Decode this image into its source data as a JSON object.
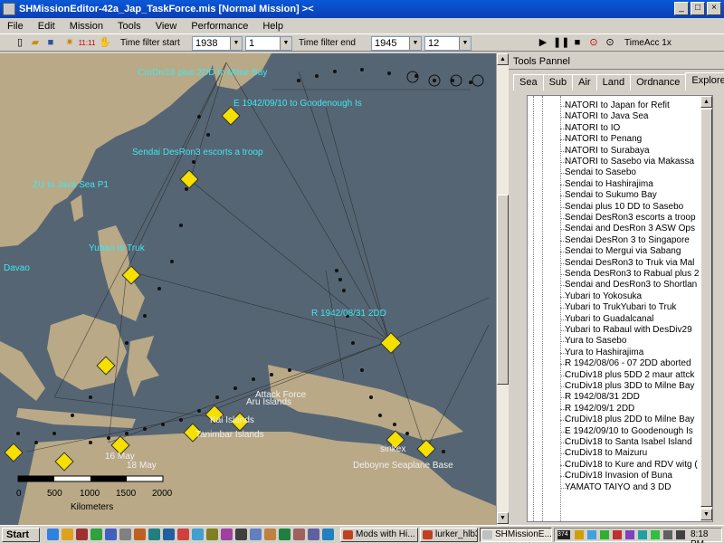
{
  "window": {
    "title": "SHMissionEditor-42a_Jap_TaskForce.mis [Normal Mission]  ><"
  },
  "menu": [
    "File",
    "Edit",
    "Mission",
    "Tools",
    "View",
    "Performance",
    "Help"
  ],
  "toolbar": {
    "time_start_label": "Time filter start",
    "start_year": "1938",
    "start_month": "1",
    "time_end_label": "Time filter end",
    "end_year": "1945",
    "end_month": "12",
    "timeacc": "TimeAcc 1x",
    "filter_icon_text": "11:11"
  },
  "map": {
    "labels": [
      "CruDiv18 plus 2DD to Milne Bay",
      "E 1942/09/10 to Goodenough Is",
      "ZU to Java Sea P1",
      "Sendai DesRon3 escorts a troop",
      "Yubari to Truk",
      "R 1942/08/31 2DD",
      "Kai Islands",
      "Aru Islands",
      "Tanimbar Islands",
      "Deboyne Seaplane Base",
      "sinkex",
      "16 May",
      "18 May",
      "Davao",
      "Attack Force"
    ],
    "scale": {
      "ticks": [
        "0",
        "500",
        "1000",
        "1500",
        "2000"
      ],
      "unit": "Kilometers"
    }
  },
  "panel": {
    "title": "Tools Pannel",
    "tabs": [
      "Sea",
      "Sub",
      "Air",
      "Land",
      "Ordnance",
      "Explorer"
    ],
    "active_tab": "Explorer",
    "tree": [
      "NATORI to Japan for Refit",
      "NATORI to Java Sea",
      "NATORI to IO",
      "NATORI to Penang",
      "NATORI to Surabaya",
      "NATORI to Sasebo via Makassa",
      "Sendai to Sasebo",
      "Sendai to Hashirajima",
      "Sendai to Sukumo Bay",
      "Sendai plus 10 DD to Sasebo",
      "Sendai DesRon3 escorts a troop",
      "Sendai and DesRon 3 ASW Ops",
      "Sendai DesRon 3 to Singapore",
      "Sendai to Mergui via Sabang",
      "Sendai DesRon3 to Truk via Mal",
      "Senda DesRon3 to Rabual plus 2",
      "Sendai and DesRon3 to Shortlan",
      "Yubari to Yokosuka",
      "Yubari to TrukYubari to Truk",
      "Yubari to Guadalcanal",
      "Yubari to Rabaul with DesDiv29",
      "Yura to Sasebo",
      "Yura to Hashirajima",
      "R 1942/08/06 - 07 2DD aborted",
      "CruDiv18 plus 5DD 2 maur attck",
      "CruDiv18 plus 3DD to Milne Bay",
      "R 1942/08/31 2DD",
      "R 1942/09/1 2DD",
      "CruDiv18 plus 2DD to Milne Bay",
      "E 1942/09/10 to Goodenough Is",
      "CruDiv18 to Santa Isabel Island",
      "CruDiv18 to Maizuru",
      "CruDiv18 to Kure and RDV witg (",
      "CruDiv18 Invasion of Buna",
      "YAMATO TAIYO and 3 DD"
    ]
  },
  "taskbar": {
    "start": "Start",
    "tasks": [
      "Mods with Hi...",
      "lurker_hlb3 -...",
      "SHMissionE..."
    ],
    "tray_badge": "374",
    "clock": "8:18 PM"
  }
}
